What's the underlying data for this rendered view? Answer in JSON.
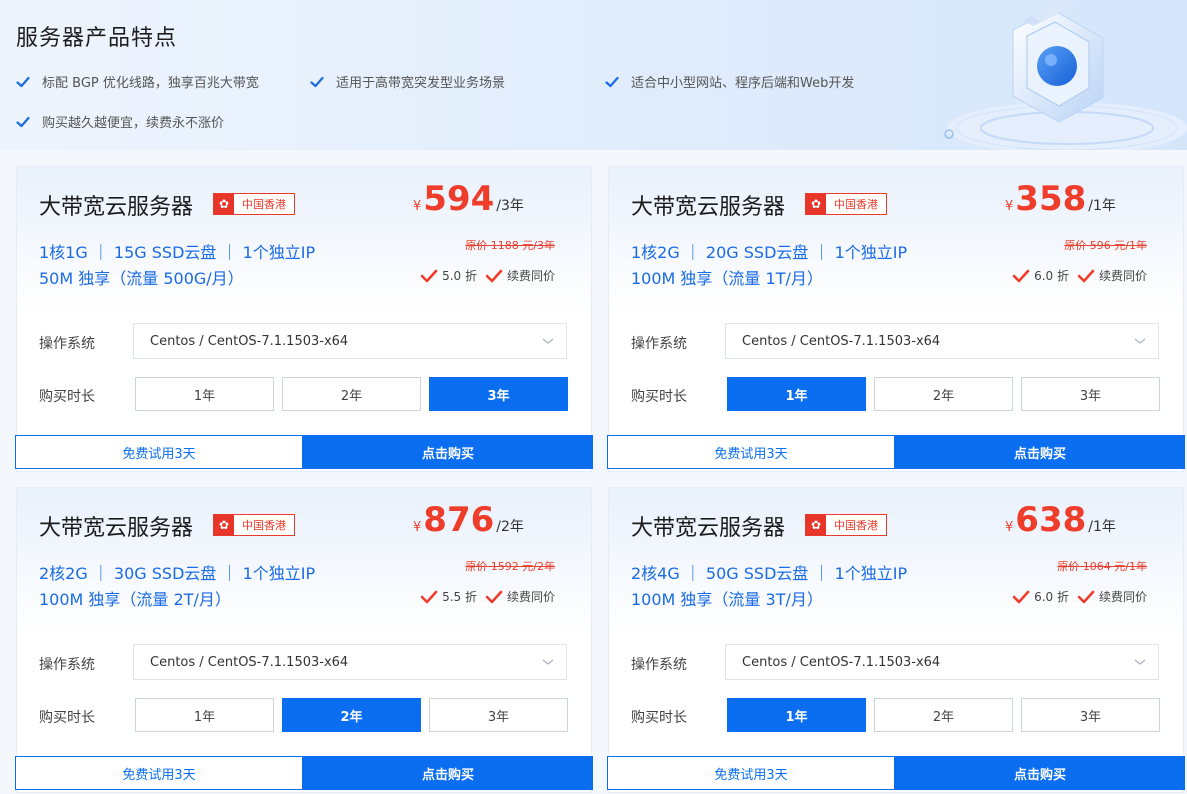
{
  "header": {
    "title": "服务器产品特点",
    "features": [
      "标配 BGP 优化线路，独享百兆大带宽",
      "适用于高带宽突发型业务场景",
      "适合中小型网站、程序后端和Web开发",
      "购买越久越便宜，续费永不涨价"
    ]
  },
  "labels": {
    "os": "操作系统",
    "duration": "购买时长",
    "trial": "免费试用3天",
    "buy": "点击购买",
    "renew": "续费同价",
    "currency": "¥"
  },
  "colors": {
    "accent": "#0b6ef0",
    "price": "#ef3d2b"
  },
  "cards": [
    {
      "name": "大带宽云服务器",
      "region": "中国香港",
      "price": "594",
      "unit": "/3年",
      "original": "原价 1188 元/3年",
      "spec1": "1核1G ｜ 15G SSD云盘 ｜ 1个独立IP",
      "spec2": "50M 独享（流量 500G/月）",
      "discount": "5.0 折",
      "os": "Centos / CentOS-7.1.1503-x64",
      "durations": [
        "1年",
        "2年",
        "3年"
      ],
      "selected": 2
    },
    {
      "name": "大带宽云服务器",
      "region": "中国香港",
      "price": "358",
      "unit": "/1年",
      "original": "原价 596 元/1年",
      "spec1": "1核2G ｜ 20G SSD云盘 ｜ 1个独立IP",
      "spec2": "100M 独享（流量 1T/月）",
      "discount": "6.0 折",
      "os": "Centos / CentOS-7.1.1503-x64",
      "durations": [
        "1年",
        "2年",
        "3年"
      ],
      "selected": 0
    },
    {
      "name": "大带宽云服务器",
      "region": "中国香港",
      "price": "876",
      "unit": "/2年",
      "original": "原价 1592 元/2年",
      "spec1": "2核2G ｜ 30G SSD云盘 ｜ 1个独立IP",
      "spec2": "100M 独享（流量 2T/月）",
      "discount": "5.5 折",
      "os": "Centos / CentOS-7.1.1503-x64",
      "durations": [
        "1年",
        "2年",
        "3年"
      ],
      "selected": 1
    },
    {
      "name": "大带宽云服务器",
      "region": "中国香港",
      "price": "638",
      "unit": "/1年",
      "original": "原价 1064 元/1年",
      "spec1": "2核4G ｜ 50G SSD云盘 ｜ 1个独立IP",
      "spec2": "100M 独享（流量 3T/月）",
      "discount": "6.0 折",
      "os": "Centos / CentOS-7.1.1503-x64",
      "durations": [
        "1年",
        "2年",
        "3年"
      ],
      "selected": 0
    }
  ]
}
